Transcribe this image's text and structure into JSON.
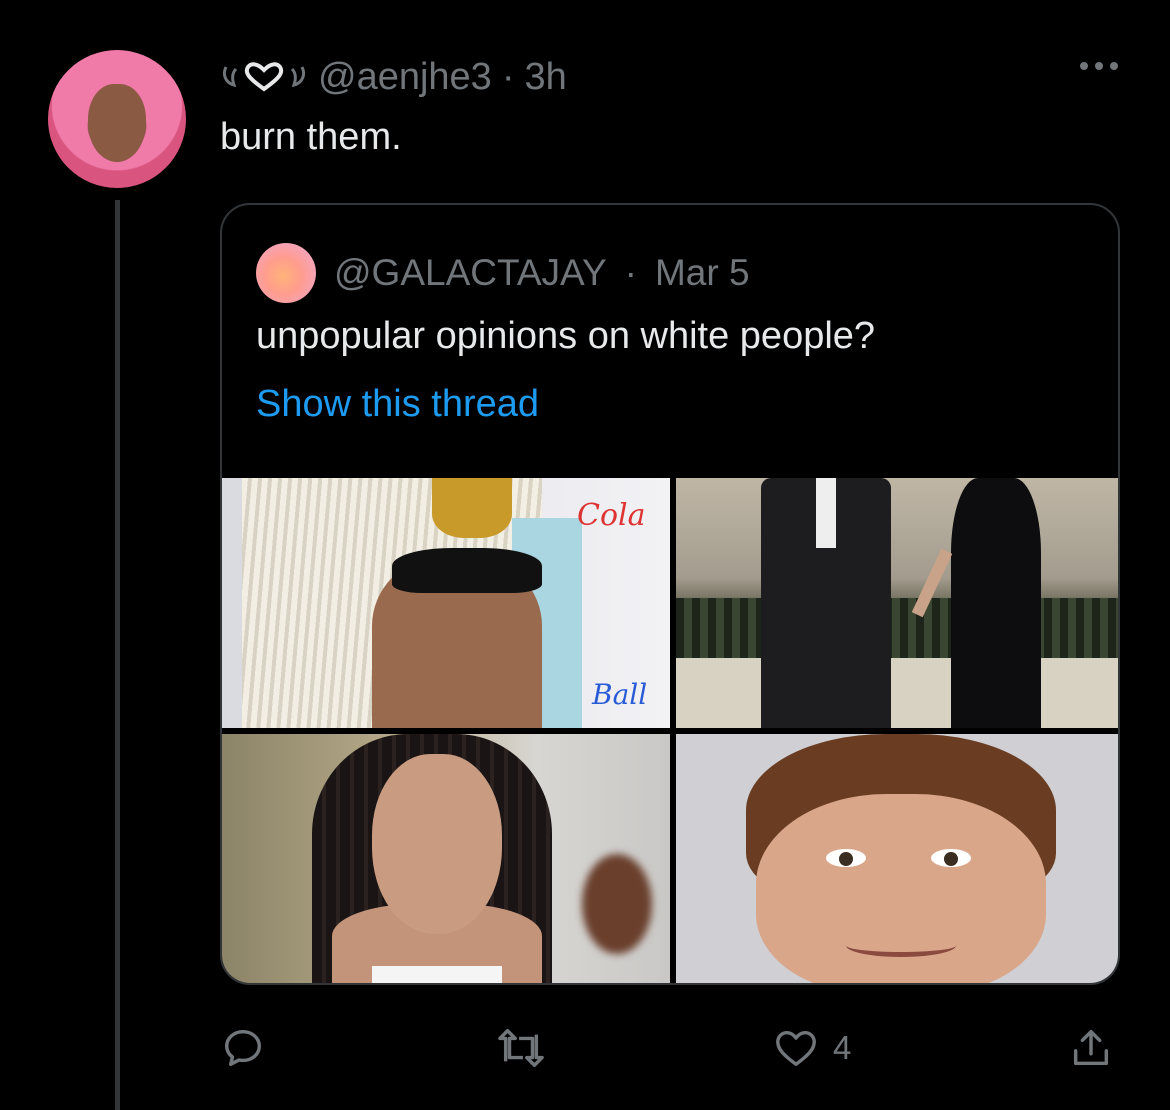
{
  "tweet": {
    "decor_glyphs": "ᕱ♡ᕲ",
    "handle": "@aenjhe3",
    "separator": "·",
    "time": "3h",
    "text": "burn them."
  },
  "quoted": {
    "handle": "@GALACTAJAY",
    "separator": "·",
    "date": "Mar 5",
    "text": "unpopular opinions on white people?",
    "show_thread": "Show this thread",
    "image_text": {
      "img1_logo": "Cola",
      "img1_ball": "Ball"
    }
  },
  "actions": {
    "reply_count": "",
    "retweet_count": "",
    "like_count": "4",
    "share_count": ""
  },
  "colors": {
    "background": "#000000",
    "text": "#e7e9ea",
    "muted": "#71767b",
    "link": "#1d9bf0",
    "border": "#333639"
  }
}
